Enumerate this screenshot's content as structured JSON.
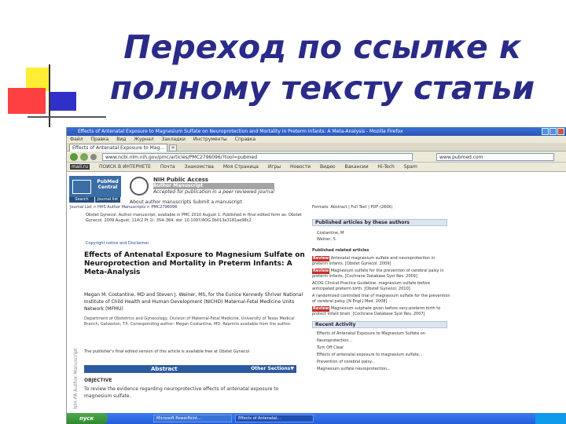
{
  "slide": {
    "title": "Переход по ссылке к полному тексту статьи"
  },
  "browser": {
    "window_title": "Effects of Antenatal Exposure to Magnesium Sulfate on Neuroprotection and Mortality in Preterm Infants: A Meta-Analysis - Mozilla Firefox",
    "menu": [
      "Файл",
      "Правка",
      "Вид",
      "Журнал",
      "Закладки",
      "Инструменты",
      "Справка"
    ],
    "tab_label": "Effects of Antenatal Exposure to Mag...",
    "address": "www.ncbi.nlm.nih.gov/pmc/articles/PMC2796096/?tool=pubmed",
    "search_value": "www.pubmed.com",
    "bookmarks": [
      "mail.ru",
      "ПОИСК В ИНТЕРНЕТЕ",
      "Почта",
      "Знакомства",
      "Моя Страница",
      "Игры",
      "Новости",
      "Видео",
      "Вакансии",
      "Hi-Tech",
      "Spam"
    ]
  },
  "page": {
    "pmc_logo": "PubMed Central",
    "pmc_tabs": [
      "Search",
      "Journal list"
    ],
    "nih_title": "NIH Public Access",
    "nih_sub1": "Author Manuscript",
    "nih_sub2": "Accepted for publication in a peer reviewed journal",
    "nih_menu": "About author manuscripts     Submit a manuscript",
    "crumb": "Journal List > HHS Author Manuscripts > PMC2796096",
    "citation": "Obstet Gynecol. Author manuscript; available in PMC 2010 August 1. Published in final edited form as: Obstet Gynecol. 2009 August; 114(2 Pt 1): 354–364. doi: 10.1097/AOG.0b013e3181ae98c2",
    "copyright": "Copyright notice and Disclaimer",
    "article_title": "Effects of Antenatal Exposure to Magnesium Sulfate on Neuroprotection and Mortality in Preterm Infants: A Meta-Analysis",
    "authors": "Megan M. Costantine, MD and Steven J. Weiner, MS, for the Eunice Kennedy Shriver National Institute of Child Health and Human Development (NICHD) Maternal-Fetal Medicine Units Network (MFMU)",
    "affiliation": "Department of Obstetrics and Gynecology, Division of Maternal-Fetal Medicine, University of Texas Medical Branch, Galveston, TX. Corresponding author: Megan Costantine, MD. Reprints available from the author.",
    "note": "The publisher's final edited version of this article is available free at Obstet Gynecol",
    "sidebar_vertical": "NIH-PA Author Manuscript",
    "abstract_label": "Abstract",
    "other_sections": "Other Sections▼",
    "objective_label": "OBJECTIVE",
    "objective_text": "To review the evidence regarding neuroprotective effects of antenatal exposure to magnesium sulfate."
  },
  "right_panel": {
    "formats": "Formats: Abstract | Full Text | PDF (280K)",
    "published_by_authors": "Published articles by these authors",
    "authors_list": [
      "Costantine, M",
      "Weiner, S"
    ],
    "related_header": "Published related articles",
    "related": [
      {
        "badge": "Review",
        "text": "Antenatal magnesium sulfate and neuroprotection in preterm infants. [Obstet Gynecol. 2009]"
      },
      {
        "badge": "Review",
        "text": "Magnesium sulfate for the prevention of cerebral palsy in preterm infants. [Cochrane Database Syst Rev. 2009]"
      },
      {
        "badge": "",
        "text": "ACOG Clinical Practice Guideline: magnesium sulfate before anticipated preterm birth. [Obstet Gynecol. 2010]"
      },
      {
        "badge": "",
        "text": "A randomized controlled trial of magnesium sulfate for the prevention of cerebral palsy. [N Engl J Med. 2008]"
      },
      {
        "badge": "Review",
        "text": "Magnesium sulphate given before very-preterm birth to protect infant brain. [Cochrane Database Syst Rev. 2007]"
      }
    ],
    "recent_activity_header": "Recent Activity",
    "recent_activity": [
      "Effects of Antenatal Exposure to Magnesium Sulfate on Neuroprotection...",
      "Turn Off   Clear",
      "Effects of antenatal exposure to magnesium sulfate...",
      "Prevention of cerebral palsy...",
      "Magnesium sulfate neuroprotection..."
    ]
  },
  "taskbar": {
    "start": "пуск",
    "tasks": [
      "Microsoft PowerPoint...",
      "Effects of Antenatal..."
    ]
  }
}
